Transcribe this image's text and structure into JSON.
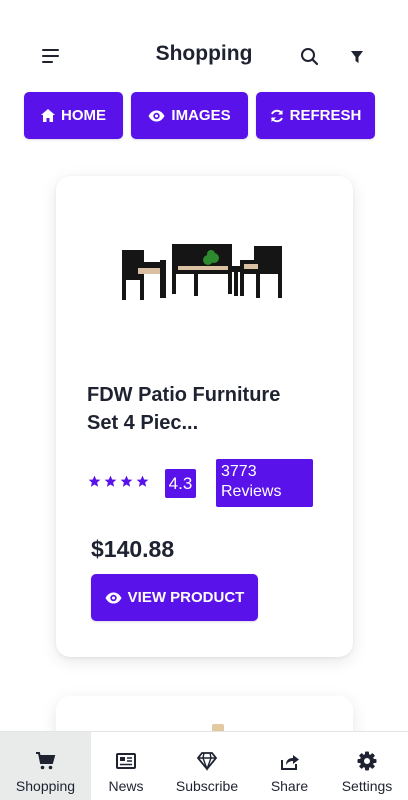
{
  "header": {
    "title": "Shopping"
  },
  "actions": {
    "home": "HOME",
    "images": "IMAGES",
    "refresh": "REFRESH"
  },
  "product": {
    "title_line1": "FDW Patio Furniture",
    "title_line2": "Set 4 Piec...",
    "stars": 4,
    "rating": "4.3",
    "reviews_line1": "3773",
    "reviews_line2": "Reviews",
    "price": "$140.88",
    "view_button": "VIEW PRODUCT"
  },
  "nav": [
    {
      "label": "Shopping",
      "icon": "cart-icon",
      "active": true
    },
    {
      "label": "News",
      "icon": "newspaper-icon",
      "active": false
    },
    {
      "label": "Subscribe",
      "icon": "diamond-icon",
      "active": false
    },
    {
      "label": "Share",
      "icon": "share-icon",
      "active": false
    },
    {
      "label": "Settings",
      "icon": "gear-icon",
      "active": false
    }
  ],
  "colors": {
    "accent": "#5a12ea",
    "text": "#1f2230",
    "nav_active_bg": "#e9eaea"
  }
}
